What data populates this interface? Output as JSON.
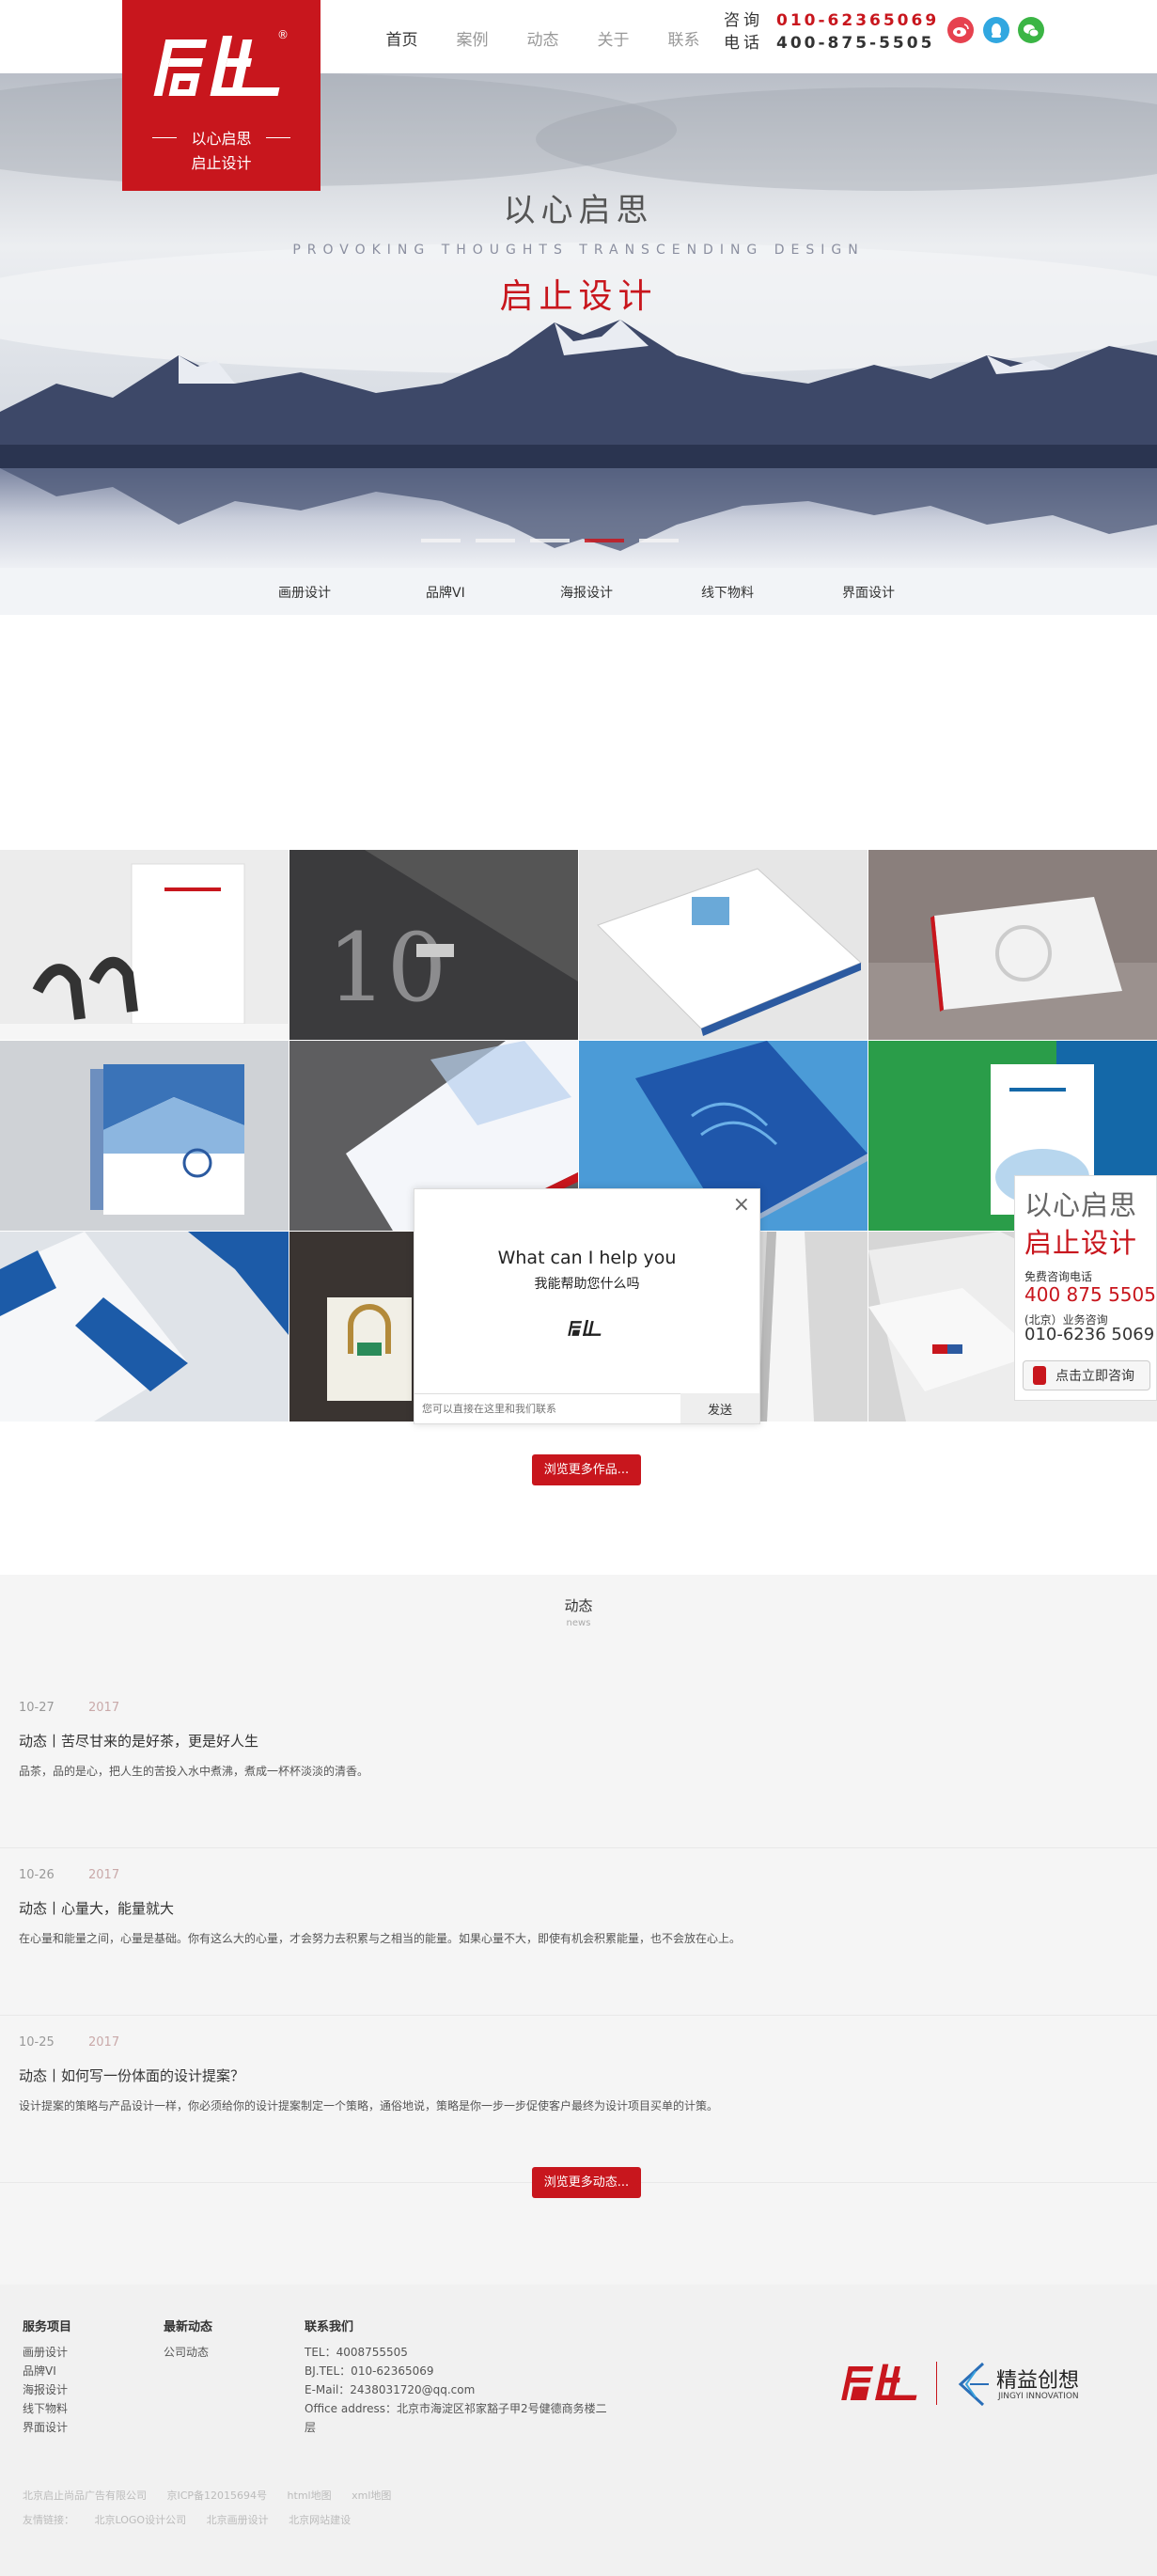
{
  "header": {
    "logo_text": "启止",
    "logo_tag_1": "以心启思",
    "logo_tag_2": "启止设计",
    "nav": [
      "首页",
      "案例",
      "动态",
      "关于",
      "联系"
    ],
    "consult_label": "咨询",
    "consult_number": "010-62365069",
    "phone_label": "电话",
    "phone_number": "400-875-5505",
    "social_icons": [
      "weibo-icon",
      "qq-icon",
      "wechat-icon"
    ],
    "social_colors": [
      "#e6424f",
      "#31a7e0",
      "#3bb545"
    ]
  },
  "banner": {
    "title": "以心启思",
    "subtitle": "PROVOKING THOUGHTS   TRANSCENDING DESIGN",
    "title2": "启止设计",
    "slide_count": 6,
    "active_slide": 4
  },
  "categories": [
    "画册设计",
    "品牌VI",
    "海报设计",
    "线下物料",
    "界面设计"
  ],
  "portfolio": {
    "more_button": "浏览更多作品..."
  },
  "chat": {
    "close": "×",
    "heading": "What can I help you",
    "subheading": "我能帮助您什么吗",
    "input_placeholder": "您可以直接在这里和我们联系",
    "send": "发送"
  },
  "consult": {
    "line1": "以心启思",
    "line2": "启止设计",
    "free_label": "免费咨询电话",
    "free_number": "400 875 5505",
    "bj_label": "(北京）业务咨询",
    "bj_number": "010-6236 5069",
    "button": "点击立即咨询"
  },
  "news": {
    "title": "动态",
    "subtitle": "news",
    "items": [
      {
        "date": "10-27",
        "year": "2017",
        "title": "动态丨苦尽甘来的是好茶，更是好人生",
        "desc": "品茶，品的是心，把人生的苦投入水中煮沸，煮成一杯杯淡淡的清香。"
      },
      {
        "date": "10-26",
        "year": "2017",
        "title": "动态丨心量大，能量就大",
        "desc": "在心量和能量之间，心量是基础。你有这么大的心量，才会努力去积累与之相当的能量。如果心量不大，即使有机会积累能量，也不会放在心上。"
      },
      {
        "date": "10-25",
        "year": "2017",
        "title": "动态丨如何写一份体面的设计提案？",
        "desc": "设计提案的策略与产品设计一样，你必须给你的设计提案制定一个策略，通俗地说，策略是你一步一步促使客户最终为设计项目买单的计策。"
      }
    ],
    "more_button": "浏览更多动态..."
  },
  "footer": {
    "col1_title": "服务项目",
    "col1_items": [
      "画册设计",
      "品牌VI",
      "海报设计",
      "线下物料",
      "界面设计"
    ],
    "col2_title": "最新动态",
    "col2_items": [
      "公司动态"
    ],
    "col3_title": "联系我们",
    "col3_items": [
      "TEL：4008755505",
      "BJ.TEL：010-62365069",
      "E-Mail：2438031720@qq.com",
      "Office address：北京市海淀区祁家豁子甲2号健德商务楼二",
      "层"
    ],
    "brand_logo": "启止",
    "partner_name": "精益创想",
    "partner_en": "JINGYI INNOVATION",
    "bottom_line1": [
      "北京启止尚品广告有限公司",
      "京ICP备12015694号",
      "html地图",
      "xml地图"
    ],
    "friends_label": "友情链接：",
    "friends": [
      "北京LOGO设计公司",
      "北京画册设计",
      "北京网站建设"
    ]
  },
  "colors": {
    "brand_red": "#c8161d",
    "footer_bg": "#f1f1f1",
    "news_bg": "#f5f5f5"
  }
}
